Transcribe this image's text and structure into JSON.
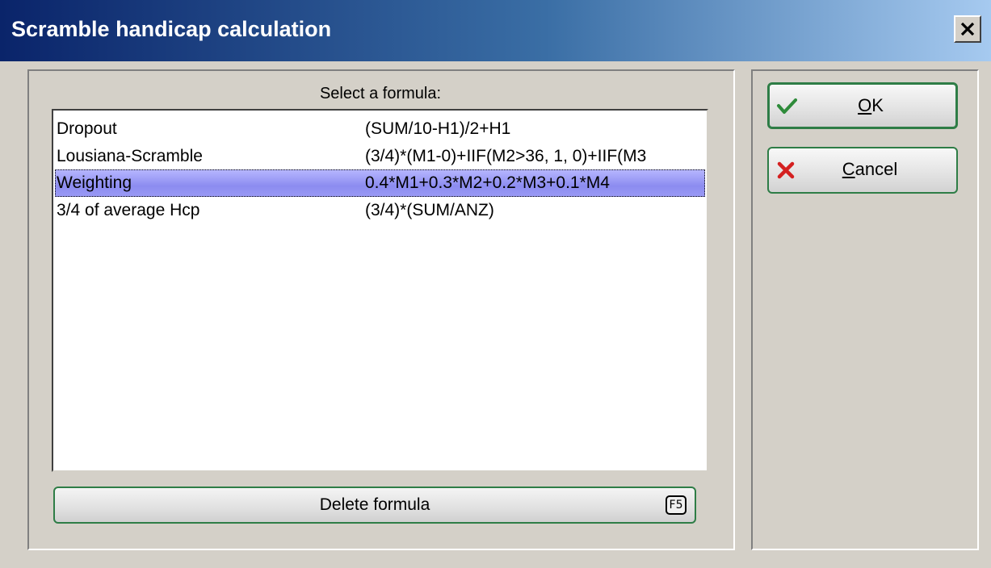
{
  "window": {
    "title": "Scramble handicap calculation"
  },
  "formula_panel": {
    "label": "Select a formula:",
    "items": [
      {
        "name": "Dropout",
        "formula": "(SUM/10-H1)/2+H1",
        "selected": false
      },
      {
        "name": "Lousiana-Scramble",
        "formula": "(3/4)*(M1-0)+IIF(M2>36, 1, 0)+IIF(M3",
        "selected": false
      },
      {
        "name": "Weighting",
        "formula": "0.4*M1+0.3*M2+0.2*M3+0.1*M4",
        "selected": true
      },
      {
        "name": "3/4 of average Hcp",
        "formula": "(3/4)*(SUM/ANZ)",
        "selected": false
      }
    ],
    "delete_button": {
      "label": "Delete formula",
      "shortcut": "F5"
    }
  },
  "buttons": {
    "ok": {
      "mnemonic": "O",
      "rest": "K",
      "icon": "checkmark-icon"
    },
    "cancel": {
      "mnemonic": "C",
      "rest": "ancel",
      "icon": "red-x-icon"
    }
  },
  "colors": {
    "title_gradient_start": "#0a246a",
    "title_gradient_end": "#a6caf0",
    "selection": "#9a9af5",
    "button_border": "#2e7d46",
    "ok_check": "#2e8b3a",
    "cancel_x": "#d42020"
  }
}
